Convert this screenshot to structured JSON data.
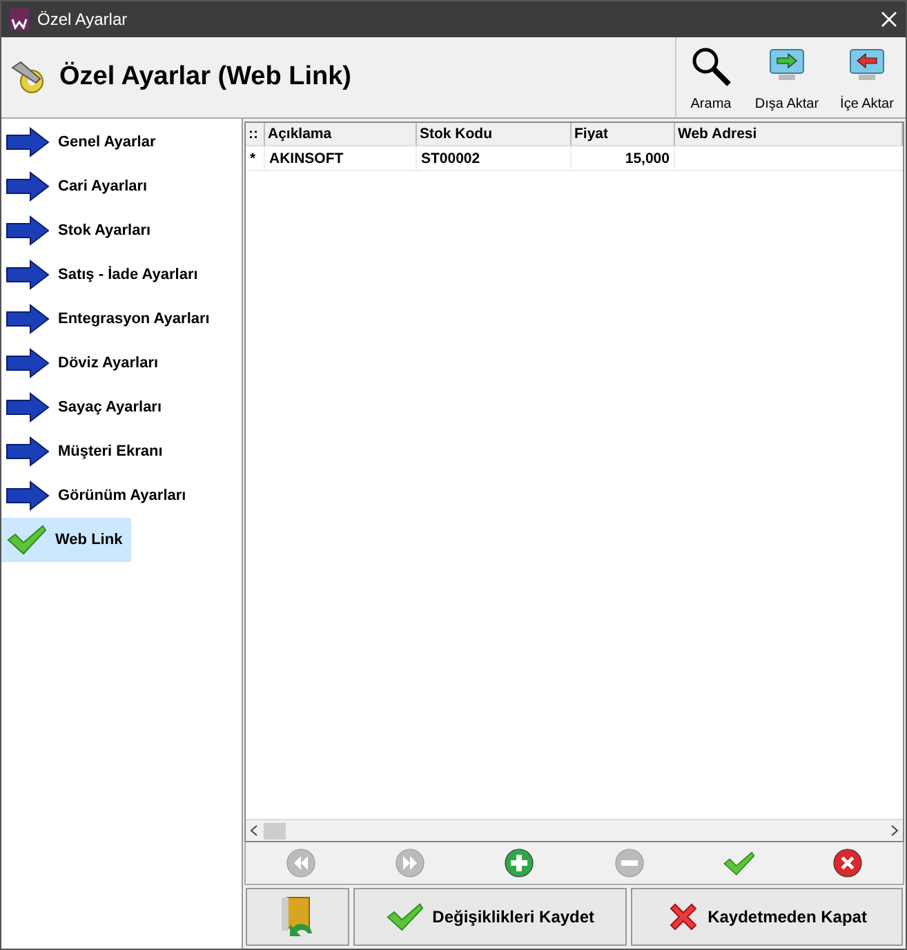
{
  "window": {
    "title": "Özel Ayarlar"
  },
  "header": {
    "title": "Özel Ayarlar (Web Link)",
    "tools": [
      {
        "kind": "search",
        "label": "Arama"
      },
      {
        "kind": "export",
        "label": "Dışa Aktar"
      },
      {
        "kind": "import",
        "label": "İçe Aktar"
      }
    ]
  },
  "sidebar": {
    "items": [
      {
        "label": "Genel Ayarlar",
        "selected": false
      },
      {
        "label": "Cari Ayarları",
        "selected": false
      },
      {
        "label": "Stok Ayarları",
        "selected": false
      },
      {
        "label": "Satış - İade Ayarları",
        "selected": false
      },
      {
        "label": "Entegrasyon Ayarları",
        "selected": false
      },
      {
        "label": "Döviz Ayarları",
        "selected": false
      },
      {
        "label": "Sayaç Ayarları",
        "selected": false
      },
      {
        "label": "Müşteri Ekranı",
        "selected": false
      },
      {
        "label": "Görünüm Ayarları",
        "selected": false
      },
      {
        "label": "Web Link",
        "selected": true
      }
    ]
  },
  "table": {
    "corner": "::",
    "columns": [
      "Açıklama",
      "Stok Kodu",
      "Fiyat",
      "Web Adresi"
    ],
    "rows": [
      {
        "marker": "*",
        "cells": [
          "AKINSOFT",
          "ST00002",
          "15,000",
          ""
        ]
      }
    ]
  },
  "navigator": [
    {
      "kind": "first",
      "disabled": true
    },
    {
      "kind": "last",
      "disabled": true
    },
    {
      "kind": "add",
      "disabled": false
    },
    {
      "kind": "delete",
      "disabled": true
    },
    {
      "kind": "post",
      "disabled": false
    },
    {
      "kind": "cancel",
      "disabled": false
    }
  ],
  "buttons": [
    {
      "kind": "exit"
    },
    {
      "kind": "save",
      "label": "Değişiklikleri Kaydet"
    },
    {
      "kind": "close",
      "label": "Kaydetmeden Kapat"
    }
  ]
}
